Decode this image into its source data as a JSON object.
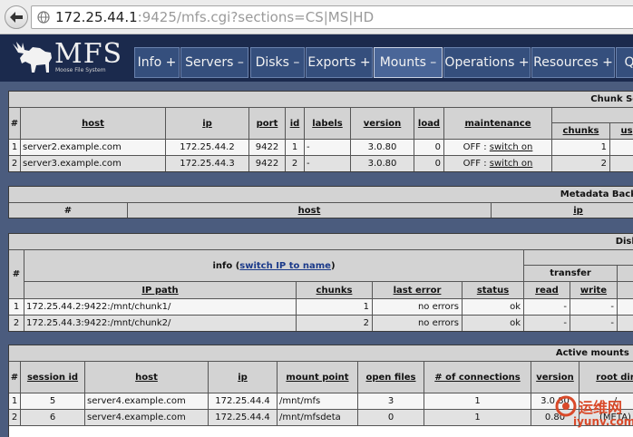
{
  "browser": {
    "url_host": "172.25.44.1",
    "url_rest": ":9425/mfs.cgi?sections=CS|MS|HD"
  },
  "header": {
    "logo_text": "MFS",
    "logo_subtitle": "Moose File System",
    "tabs": [
      "Info +",
      "Servers –",
      "Disks –",
      "Exports +",
      "Mounts –",
      "Operations +",
      "Resources +",
      "Q"
    ],
    "active_tab": "Mounts –"
  },
  "chunk_servers": {
    "title": "Chunk Ser",
    "headers": [
      "#",
      "host",
      "ip",
      "port",
      "id",
      "labels",
      "version",
      "load",
      "maintenance",
      "chunks",
      "us"
    ],
    "rows": [
      {
        "num": "1",
        "host": "server2.example.com",
        "ip": "172.25.44.2",
        "port": "9422",
        "id": "1",
        "labels": "-",
        "version": "3.0.80",
        "load": "0",
        "maint": "OFF : ",
        "maint_link": "switch on",
        "chunks": "1"
      },
      {
        "num": "2",
        "host": "server3.example.com",
        "ip": "172.25.44.3",
        "port": "9422",
        "id": "2",
        "labels": "-",
        "version": "3.0.80",
        "load": "0",
        "maint": "OFF : ",
        "maint_link": "switch on",
        "chunks": "2"
      }
    ]
  },
  "metadata_backup": {
    "title": "Metadata Backu",
    "headers": [
      "#",
      "host",
      "ip"
    ]
  },
  "disks": {
    "title": "Disks",
    "info_label": "info (",
    "info_link": "switch IP to name",
    "info_close": ")",
    "headers": [
      "#",
      "IP path",
      "chunks",
      "last error",
      "status",
      "transfer",
      "read",
      "write"
    ],
    "rows": [
      {
        "num": "1",
        "path": "172.25.44.2:9422:/mnt/chunk1/",
        "chunks": "1",
        "error": "no errors",
        "status": "ok",
        "read": "-",
        "write": "-"
      },
      {
        "num": "2",
        "path": "172.25.44.3:9422:/mnt/chunk2/",
        "chunks": "2",
        "error": "no errors",
        "status": "ok",
        "read": "-",
        "write": "-"
      }
    ]
  },
  "active_mounts": {
    "title": "Active mounts (p",
    "headers": [
      "#",
      "session id",
      "host",
      "ip",
      "mount point",
      "open files",
      "# of connections",
      "version",
      "root dir"
    ],
    "rows": [
      {
        "num": "1",
        "session": "5",
        "host": "server4.example.com",
        "ip": "172.25.44.4",
        "mount": "/mnt/mfs",
        "open": "3",
        "conns": "1",
        "version": "3.0.80",
        "root": "/"
      },
      {
        "num": "2",
        "session": "6",
        "host": "server4.example.com",
        "ip": "172.25.44.4",
        "mount": "/mnt/mfsdeta",
        "open": "0",
        "conns": "1",
        "version": "0.80",
        "root": "(META)"
      }
    ]
  },
  "watermark": {
    "line1": "运维网",
    "line2": "iyunv.com"
  }
}
